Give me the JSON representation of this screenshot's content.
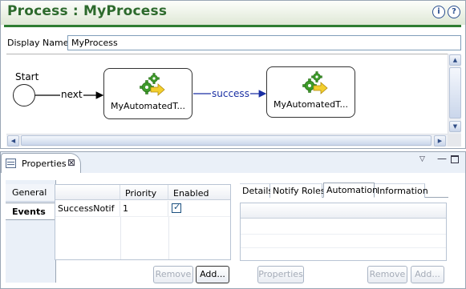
{
  "editor": {
    "title": "Process : MyProcess",
    "help_info_label": "i",
    "help_label": "?",
    "display_name_label": "Display Name",
    "display_name_value": "MyProcess"
  },
  "diagram": {
    "start_label": "Start",
    "edges": [
      {
        "from": "Start",
        "to": "task1",
        "label": "next"
      },
      {
        "from": "task1",
        "to": "task2",
        "label": "success"
      }
    ],
    "tasks": [
      {
        "id": "task1",
        "label": "MyAutomatedT..."
      },
      {
        "id": "task2",
        "label": "MyAutomatedT..."
      }
    ],
    "edge_colors": {
      "next": "#000000",
      "success": "#1a2fa3"
    }
  },
  "properties": {
    "tab_label": "Properties",
    "close_glyph": "⊠",
    "menu_glyph": "▽",
    "minimize_glyph": "—",
    "side_tabs": [
      "General",
      "Events"
    ],
    "active_side_tab": "Events",
    "events_table": {
      "columns": [
        "",
        "Priority",
        "Enabled"
      ],
      "rows": [
        {
          "name": "SuccessNotif",
          "priority": "1",
          "enabled": true
        }
      ]
    },
    "event_buttons": {
      "remove": "Remove",
      "add": "Add..."
    },
    "detail_tabs": [
      "Details",
      "Notify Roles",
      "Automation",
      "Information"
    ],
    "active_detail_tab": "Automation",
    "detail_buttons": {
      "properties": "Properties",
      "remove": "Remove",
      "add": "Add..."
    }
  },
  "colors": {
    "title_green": "#2d6a2d",
    "rule_green": "#2e7d32",
    "panel_blue": "#eaf0f8"
  },
  "icons": [
    "help-info-icon",
    "help-icon",
    "gear-arrow-icon",
    "properties-view-icon",
    "close-icon",
    "view-menu-icon",
    "minimize-icon",
    "maximize-icon",
    "scroll-up-icon",
    "scroll-down-icon",
    "scroll-left-icon",
    "scroll-right-icon",
    "checkbox-checked-icon"
  ]
}
